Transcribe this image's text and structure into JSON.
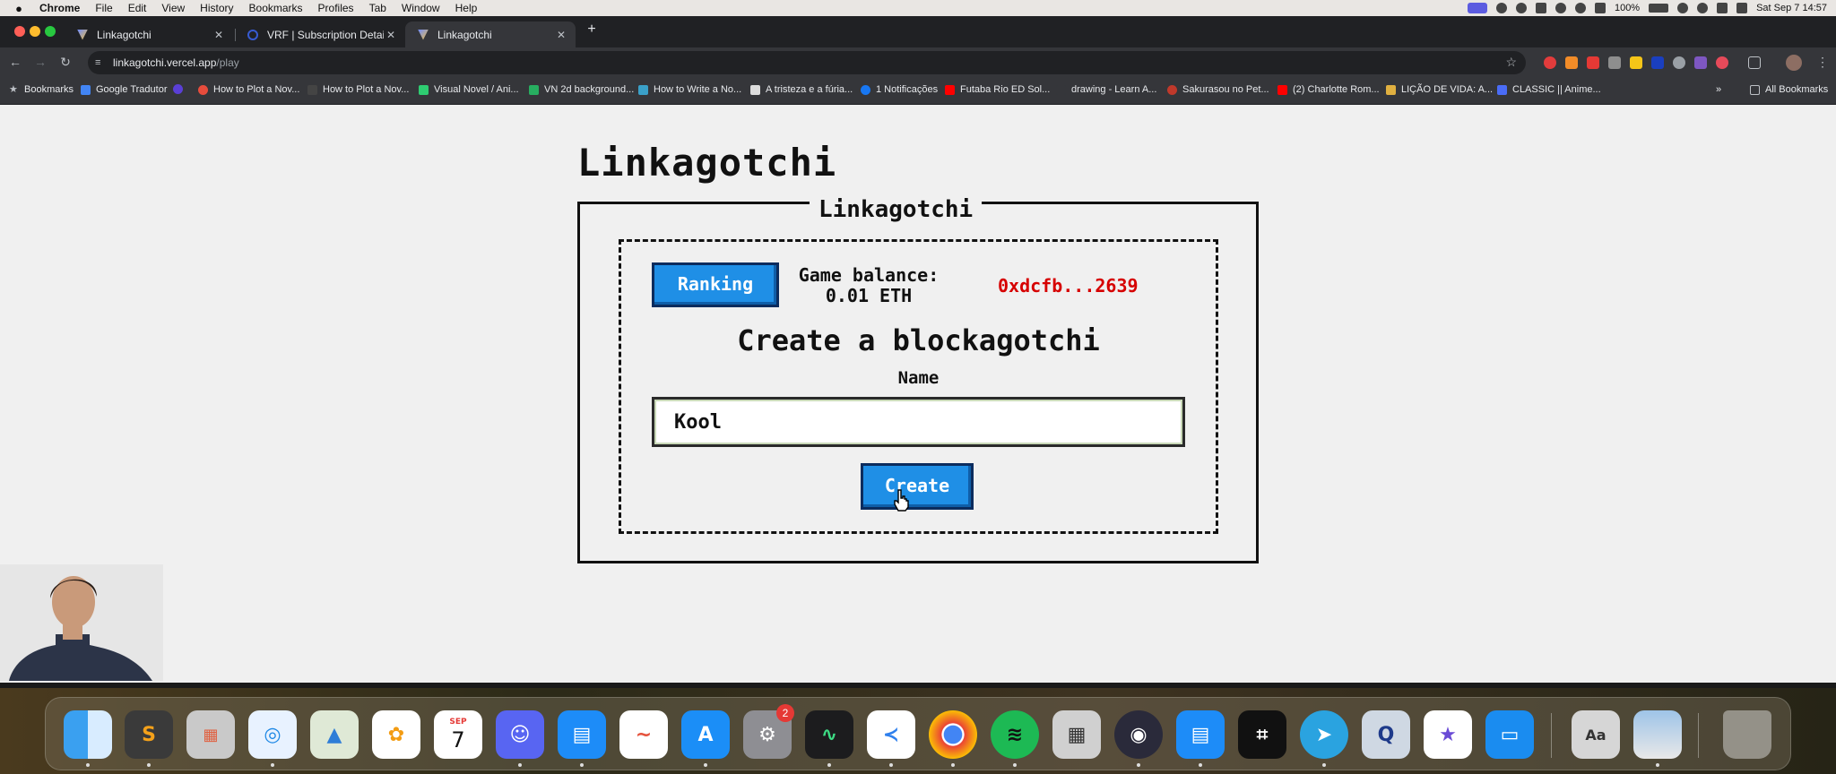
{
  "menubar": {
    "app": "Chrome",
    "items": [
      "File",
      "Edit",
      "View",
      "History",
      "Bookmarks",
      "Profiles",
      "Tab",
      "Window",
      "Help"
    ],
    "battery": "100%",
    "datetime": "Sat Sep 7  14:57"
  },
  "tabs": [
    {
      "title": "Linkagotchi",
      "active": false
    },
    {
      "title": "VRF | Subscription Details",
      "active": false
    },
    {
      "title": "Linkagotchi",
      "active": true
    }
  ],
  "address_bar": {
    "host": "linkagotchi.vercel.app",
    "path": "/play"
  },
  "bookmarks": {
    "first": "Bookmarks",
    "items": [
      "Google Tradutor",
      "How to Plot a Nov...",
      "How to Plot a Nov...",
      "Visual Novel / Ani...",
      "VN 2d background...",
      "How to Write a No...",
      "A tristeza e a fúria...",
      "1 Notificações",
      "Futaba Rio ED Sol...",
      "drawing - Learn A...",
      "Sakurasou no Pet...",
      "(2) Charlotte Rom...",
      "LIÇÃO DE VIDA: A...",
      "CLASSIC || Anime..."
    ],
    "all": "All Bookmarks"
  },
  "page": {
    "title": "Linkagotchi",
    "panel_legend": "Linkagotchi",
    "ranking_label": "Ranking",
    "balance_label": "Game balance:",
    "balance_value": "0.01 ETH",
    "address": "0xdcfb...2639",
    "create_heading": "Create a blockagotchi",
    "name_label": "Name",
    "name_value": "Kool",
    "create_label": "Create"
  },
  "dock": {
    "badge": "2",
    "calendar_month": "SEP",
    "calendar_day": "7"
  },
  "colors": {
    "accent_blue": "#1f8fe6",
    "address_red": "#d60000",
    "page_bg": "#f0f0f0"
  }
}
